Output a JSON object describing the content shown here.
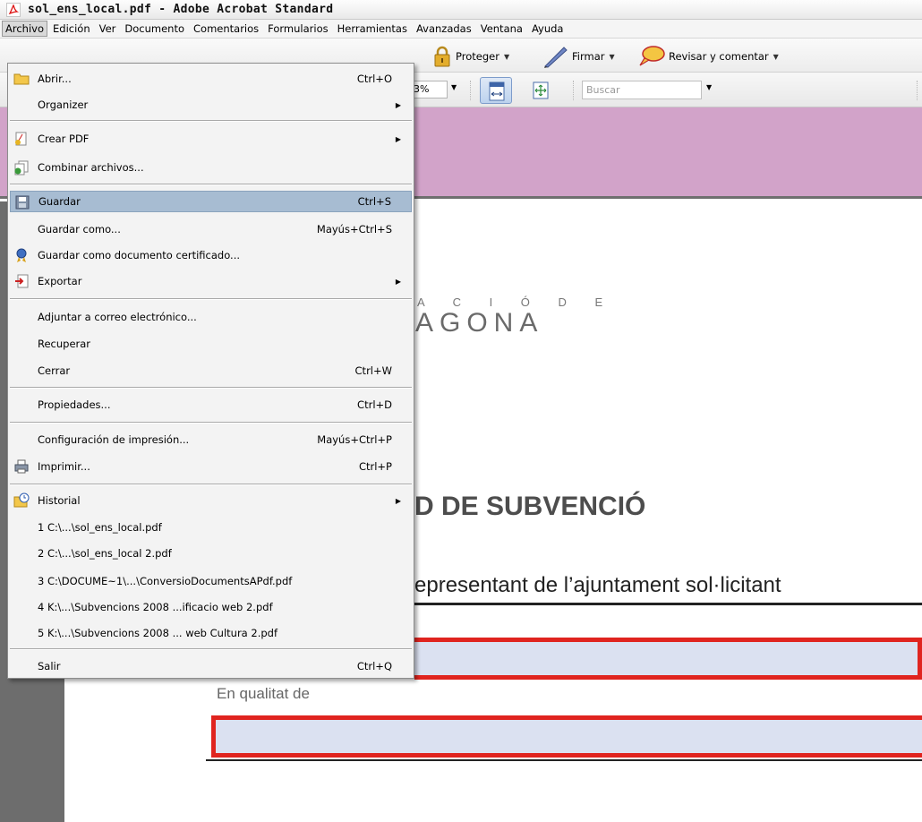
{
  "window": {
    "title": "sol_ens_local.pdf - Adobe Acrobat Standard"
  },
  "menubar": {
    "items": [
      "Archivo",
      "Edición",
      "Ver",
      "Documento",
      "Comentarios",
      "Formularios",
      "Herramientas",
      "Avanzadas",
      "Ventana",
      "Ayuda"
    ],
    "active": "Archivo"
  },
  "toolbar": {
    "proteger": "Proteger",
    "firmar": "Firmar",
    "revisar": "Revisar y comentar",
    "zoom": "3%",
    "search_placeholder": "Buscar"
  },
  "file_menu": {
    "items": [
      {
        "label": "Abrir...",
        "shortcut": "Ctrl+O",
        "icon": "folder-icon"
      },
      {
        "label": "Organizer",
        "submenu": true
      },
      {
        "label": "Crear PDF",
        "submenu": true,
        "icon": "create-pdf-icon"
      },
      {
        "label": "Combinar archivos...",
        "icon": "combine-files-icon"
      },
      {
        "label": "Guardar",
        "shortcut": "Ctrl+S",
        "icon": "save-disk-icon",
        "highlighted": true
      },
      {
        "label": "Guardar como...",
        "shortcut": "Mayús+Ctrl+S"
      },
      {
        "label": "Guardar como documento certificado...",
        "icon": "certified-ribbon-icon"
      },
      {
        "label": "Exportar",
        "submenu": true,
        "icon": "export-icon"
      },
      {
        "label": "Adjuntar a correo electrónico..."
      },
      {
        "label": "Recuperar"
      },
      {
        "label": "Cerrar",
        "shortcut": "Ctrl+W"
      },
      {
        "label": "Propiedades...",
        "shortcut": "Ctrl+D"
      },
      {
        "label": "Configuración de impresión...",
        "shortcut": "Mayús+Ctrl+P"
      },
      {
        "label": "Imprimir...",
        "shortcut": "Ctrl+P",
        "icon": "printer-icon"
      },
      {
        "label": "Historial",
        "submenu": true,
        "icon": "history-icon"
      },
      {
        "label": "1 C:\\...\\sol_ens_local.pdf"
      },
      {
        "label": "2 C:\\...\\sol_ens_local 2.pdf"
      },
      {
        "label": "3 C:\\DOCUME~1\\...\\ConversioDocumentsAPdf.pdf"
      },
      {
        "label": "4 K:\\...\\Subvencions 2008 ...ificacio web 2.pdf"
      },
      {
        "label": "5 K:\\...\\Subvencions 2008 ... web Cultura 2.pdf"
      },
      {
        "label": "Salir",
        "shortcut": "Ctrl+Q"
      }
    ],
    "submenu_arrow": "▶"
  },
  "document": {
    "logo_line1": "A C I Ó   D E",
    "logo_line2": "AGONA",
    "heading": "D DE SUBVENCIÓ",
    "line1": "epresentant de l’ajuntament sol·licitant",
    "label": "En qualitat de"
  },
  "colors": {
    "highlight": "#a7bcd2",
    "pink_bar": "#d2a3c9",
    "field_border": "#e0241f",
    "field_fill": "#dbe1f1"
  }
}
